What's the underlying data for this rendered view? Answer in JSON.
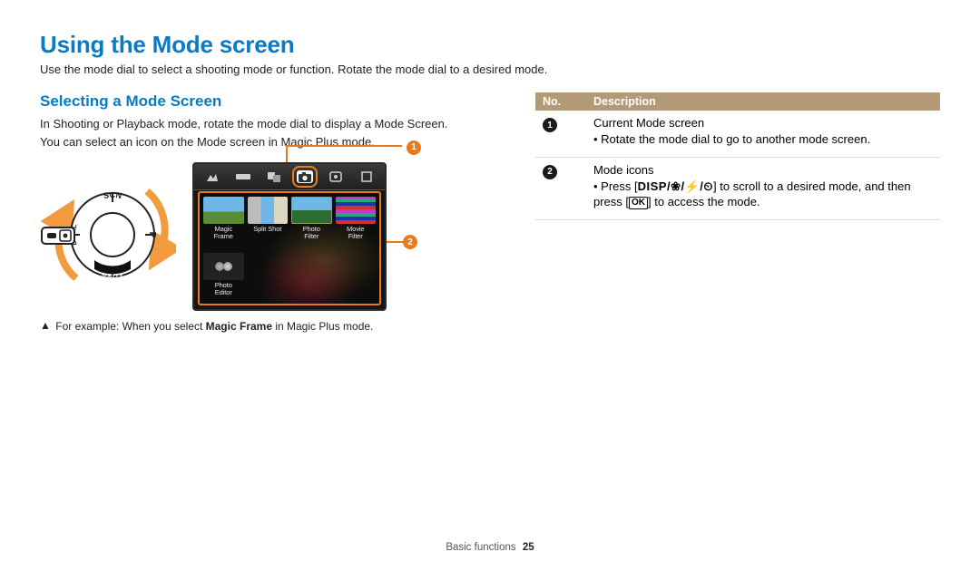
{
  "title": "Using the Mode screen",
  "intro": "Use the mode dial to select a shooting mode or function. Rotate the mode dial to a desired mode.",
  "subheading": "Selecting a Mode Screen",
  "body_line1": "In Shooting or Playback mode, rotate the mode dial to display a Mode Screen.",
  "body_line2": "You can select an icon on the Mode screen in Magic Plus mode.",
  "caption_prefix": "For example: When you select ",
  "caption_bold": "Magic Frame",
  "caption_suffix": " in Magic Plus mode.",
  "callout1_num": "1",
  "callout2_num": "2",
  "dial_labels": {
    "top": "SCN",
    "right": "P",
    "bottom": "AUTO",
    "left": "DUAL"
  },
  "modebar_icons": [
    "scene-icon",
    "panorama-icon",
    "dual-icon",
    "camera-icon",
    "auto-icon",
    "program-icon"
  ],
  "modebar_selected_index": 3,
  "tiles": [
    {
      "label": "Magic\nFrame",
      "kind": "landscape"
    },
    {
      "label": "Split Shot",
      "kind": "split"
    },
    {
      "label": "Photo\nFilter",
      "kind": "filter"
    },
    {
      "label": "Movie\nFilter",
      "kind": "movie"
    },
    {
      "label": "Photo\nEditor",
      "kind": "editor"
    }
  ],
  "table": {
    "head_no": "No.",
    "head_desc": "Description",
    "rows": [
      {
        "num": "1",
        "title": "Current Mode screen",
        "bullets": [
          "Rotate the mode dial to go to another mode screen."
        ]
      },
      {
        "num": "2",
        "title": "Mode icons",
        "bullets_rich": {
          "before": "Press [",
          "icons": "DISP/❀/⚡/⏲",
          "mid": "] to scroll to a desired mode, and then press [",
          "ok": "OK",
          "after": "] to access the mode."
        }
      }
    ]
  },
  "footer_section": "Basic functions",
  "footer_page": "25"
}
